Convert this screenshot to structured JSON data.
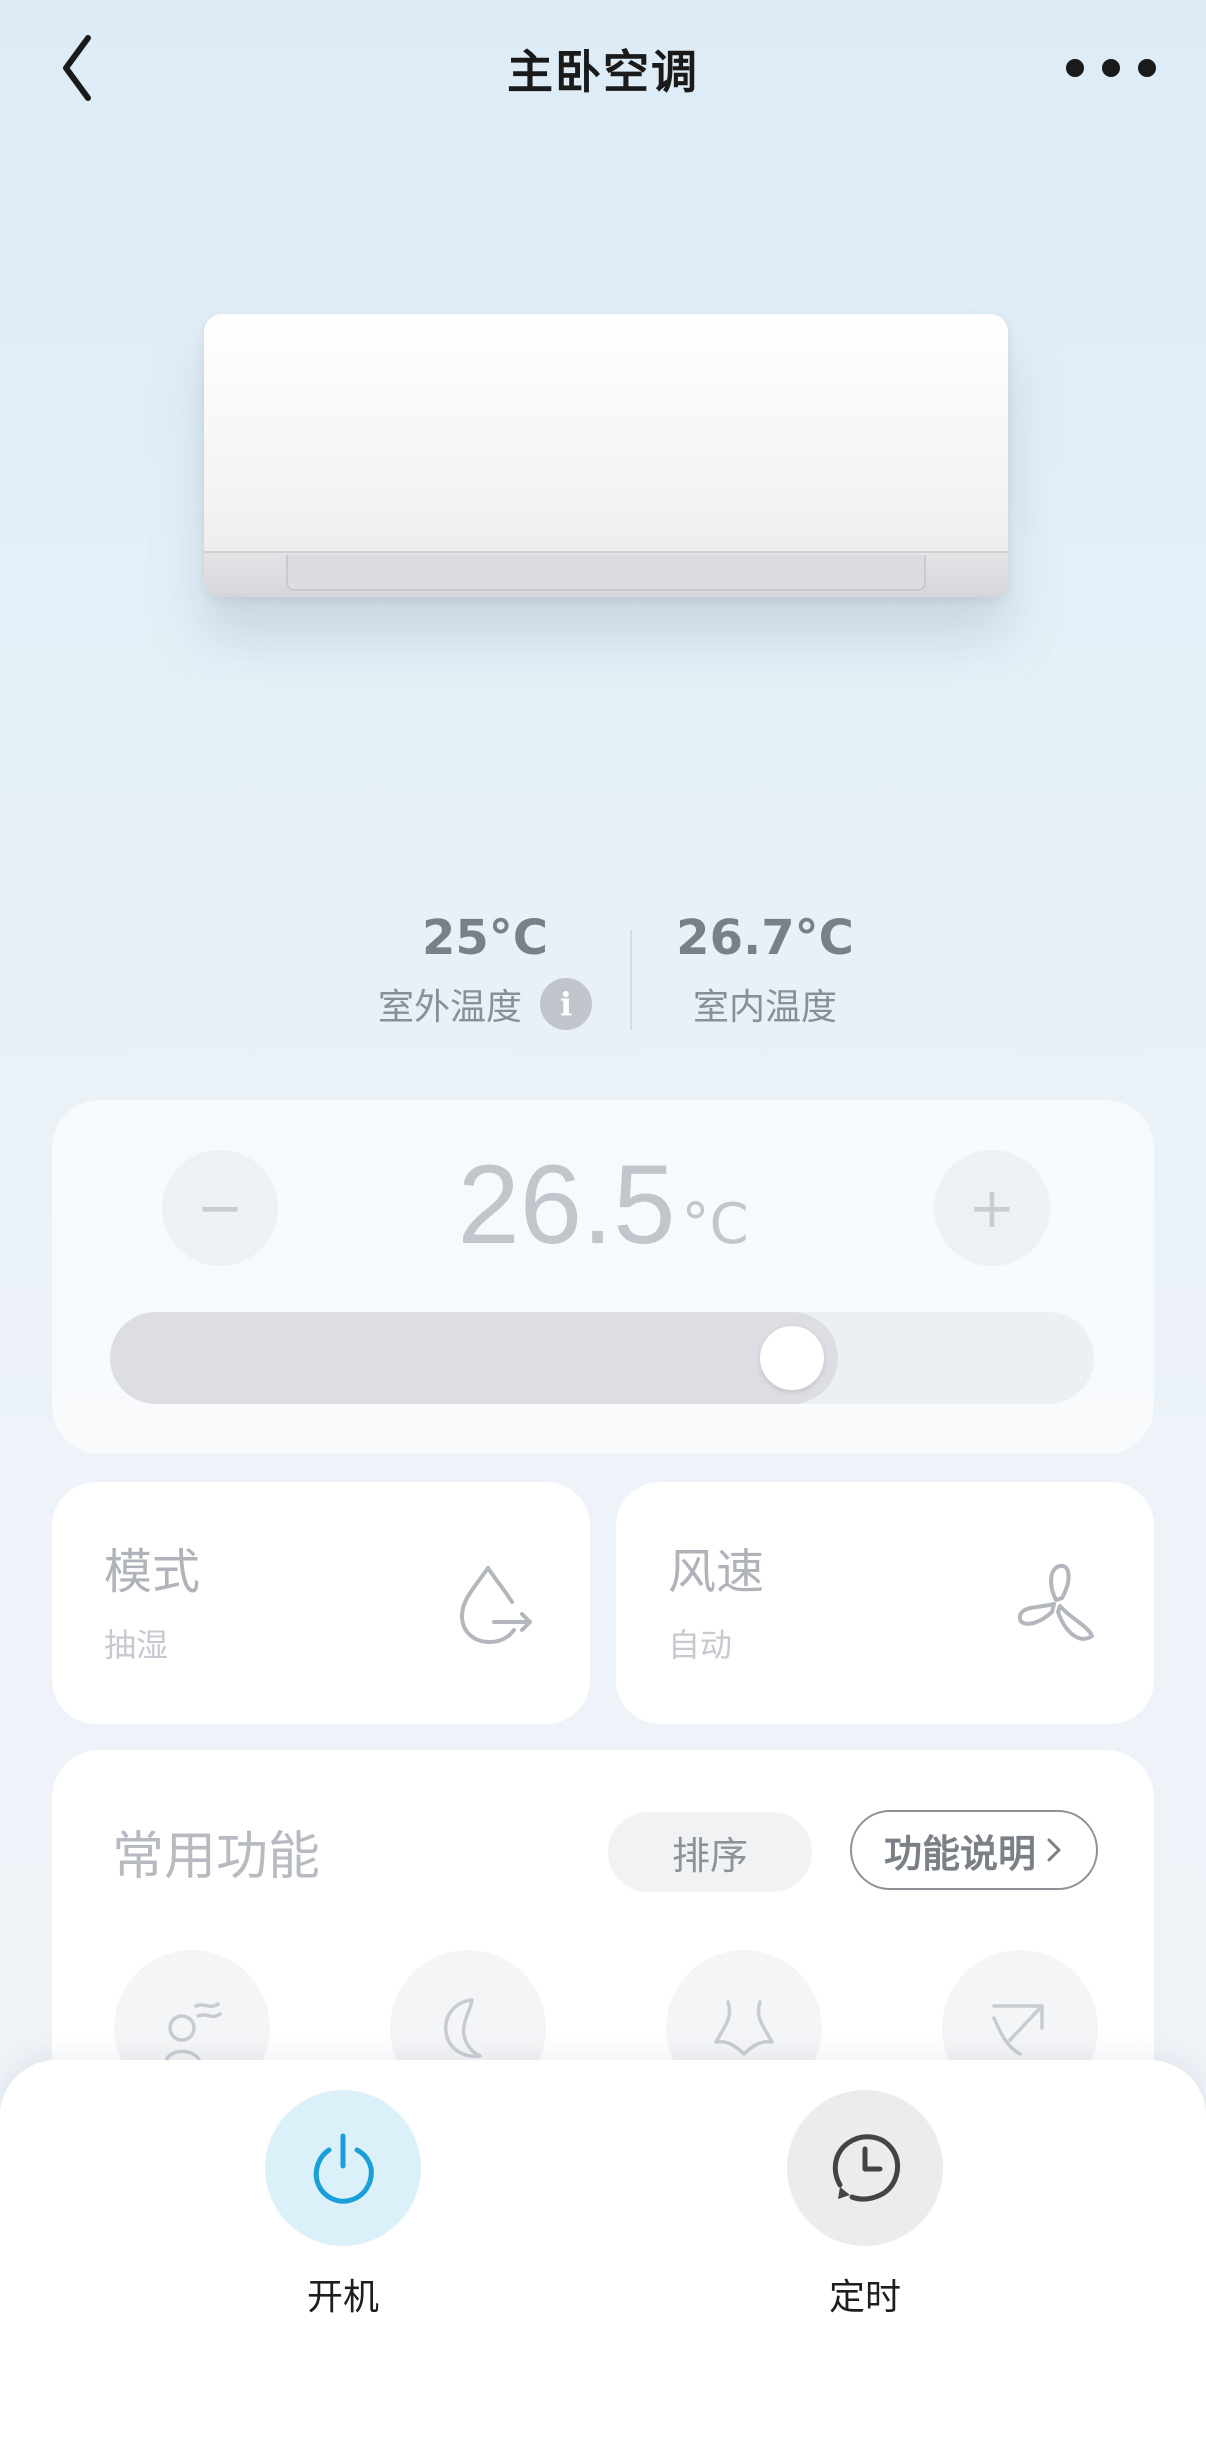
{
  "header": {
    "title": "主卧空调"
  },
  "temperatures": {
    "outdoor": {
      "value": "25°C",
      "label": "室外温度",
      "info": "i"
    },
    "indoor": {
      "value": "26.7°C",
      "label": "室内温度"
    }
  },
  "setpoint": {
    "value": "26.5",
    "unit": "°C",
    "decrease": "−",
    "increase": "+",
    "slider_fraction": 0.74
  },
  "mode_tile": {
    "title": "模式",
    "value": "抽湿",
    "icon": "droplet-icon"
  },
  "fan_tile": {
    "title": "风速",
    "value": "自动",
    "icon": "fan-icon"
  },
  "functions": {
    "title": "常用功能",
    "sort_label": "排序",
    "help_label": "功能说明",
    "items": [
      {
        "icon": "sleep-person-icon"
      },
      {
        "icon": "moon-icon"
      },
      {
        "icon": "comfort-icon"
      },
      {
        "icon": "airflow-icon"
      }
    ]
  },
  "actions": {
    "power": {
      "label": "开机",
      "icon": "power-icon",
      "color": "#1a9fd8"
    },
    "timer": {
      "label": "定时",
      "icon": "clock-icon"
    }
  }
}
